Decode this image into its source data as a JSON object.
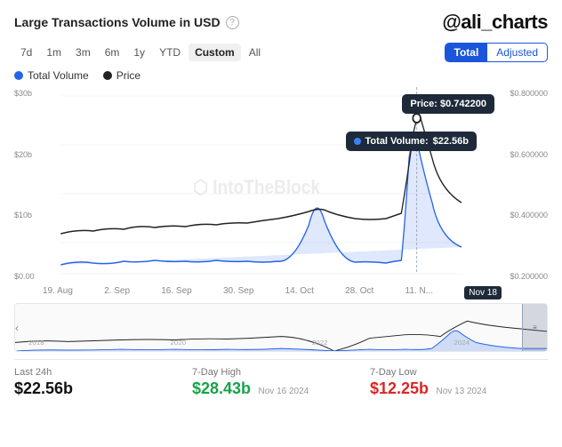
{
  "header": {
    "title": "Large Transactions Volume in USD",
    "info_icon": "?",
    "watermark": "@ali_charts"
  },
  "time_filters": [
    {
      "label": "7d",
      "active": false
    },
    {
      "label": "1m",
      "active": false
    },
    {
      "label": "3m",
      "active": false
    },
    {
      "label": "6m",
      "active": false
    },
    {
      "label": "1y",
      "active": false
    },
    {
      "label": "YTD",
      "active": false
    },
    {
      "label": "Custom",
      "active": true
    },
    {
      "label": "All",
      "active": false
    }
  ],
  "view_toggle": {
    "total": "Total",
    "adjusted": "Adjusted",
    "active": "Total"
  },
  "legend": [
    {
      "label": "Total Volume",
      "color": "#2563eb"
    },
    {
      "label": "Price",
      "color": "#222"
    }
  ],
  "y_axis_left": [
    "$30b",
    "$20b",
    "$10b",
    "$0.00"
  ],
  "y_axis_right": [
    "$0.800000",
    "$0.600000",
    "$0.400000",
    "$0.200000"
  ],
  "date_labels": [
    "19. Aug",
    "2. Sep",
    "16. Sep",
    "30. Sep",
    "14. Oct",
    "28. Oct",
    "11. N...",
    "Nov 18"
  ],
  "tooltip_price": {
    "label": "Price:",
    "value": "$0.742200"
  },
  "tooltip_volume": {
    "label": "Total Volume:",
    "value": "$22.56b"
  },
  "mini_chart_years": [
    "2018",
    "2020",
    "2022",
    "2024"
  ],
  "stats": [
    {
      "label": "Last 24h",
      "value": "$22.56b",
      "color": "normal",
      "meta": ""
    },
    {
      "label": "7-Day High",
      "value": "$28.43b",
      "color": "green",
      "meta": "Nov 16 2024"
    },
    {
      "label": "7-Day Low",
      "value": "$12.25b",
      "color": "red",
      "meta": "Nov 13 2024"
    }
  ]
}
